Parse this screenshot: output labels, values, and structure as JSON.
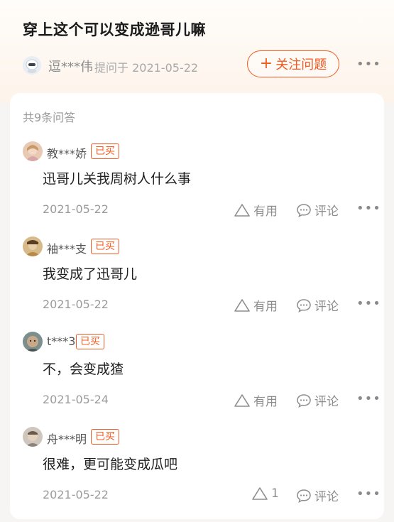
{
  "question": {
    "title": "穿上这个可以变成逊哥儿嘛",
    "asker": "逗***伟",
    "asked_meta": "提问于 2021-05-22",
    "follow_label": "关注问题",
    "follow_icon": "plus-icon",
    "more": "•••"
  },
  "answers_count": "共9条问答",
  "answers": [
    {
      "user": "教***娇",
      "badge": "已买",
      "text": "迅哥儿关我周树人什么事",
      "date": "2021-05-22",
      "useful": "有用",
      "comment": "评论",
      "more": "•••"
    },
    {
      "user": "袖***支",
      "badge": "已买",
      "text": "我变成了迅哥儿",
      "date": "2021-05-22",
      "useful": "有用",
      "comment": "评论",
      "more": "•••"
    },
    {
      "user": "t***3",
      "badge": "已买",
      "text": "不，会变成猹",
      "date": "2021-05-24",
      "useful": "有用",
      "comment": "评论",
      "more": "•••"
    },
    {
      "user": "舟***明",
      "badge": "已买",
      "text": "很难，更可能变成瓜吧",
      "date": "2021-05-22",
      "useful": "1",
      "comment": "评论",
      "more": "•••"
    }
  ],
  "colors": {
    "accent": "#f15a22",
    "muted": "#9b9b9b"
  }
}
